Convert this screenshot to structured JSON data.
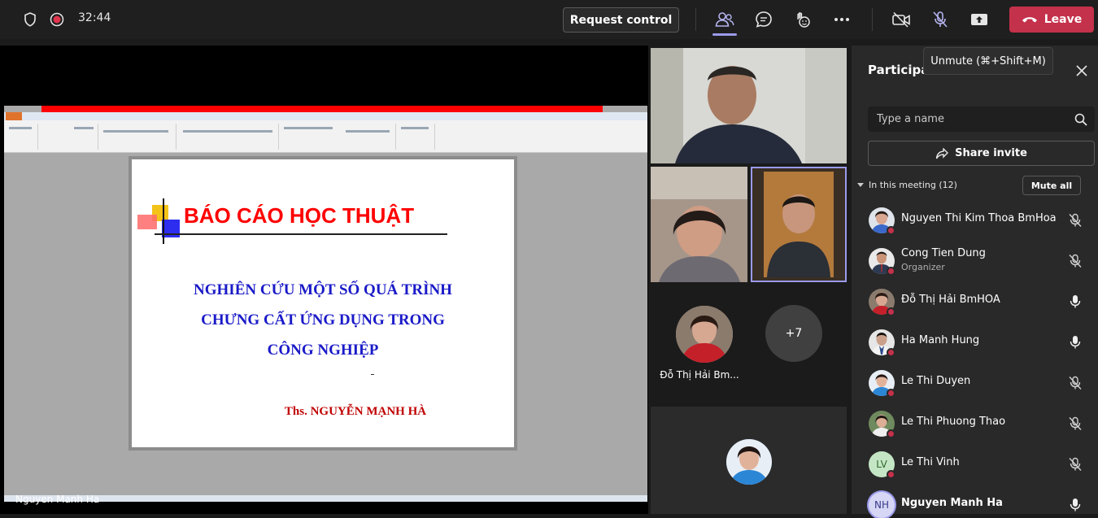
{
  "header": {
    "timer": "32:44",
    "request_control_label": "Request control",
    "leave_label": "Leave"
  },
  "tooltip": {
    "text": "Unmute (⌘+Shift+M)"
  },
  "presentation": {
    "slide_main_title": "BÁO CÁO HỌC THUẬT",
    "slide_subtitle_lines": [
      "NGHIÊN CỨU MỘT SỐ QUÁ TRÌNH",
      "CHƯNG CẤT ỨNG DỤNG TRONG",
      "CÔNG NGHIỆP"
    ],
    "slide_author": "Ths. NGUYỄN MẠNH HÀ",
    "presenter_name": "Nguyen Manh Ha"
  },
  "gallery": {
    "tile_label": "Đỗ Thị Hải Bm...",
    "more_count": "+7"
  },
  "panel": {
    "title": "Participa",
    "search_placeholder": "Type a name",
    "share_invite_label": "Share invite",
    "in_meeting_label": "In this meeting (12)",
    "mute_all_label": "Mute all",
    "participants": [
      {
        "name": "Nguyen Thi Kim Thoa BmHoa",
        "role": "",
        "mic": "muted"
      },
      {
        "name": "Cong Tien Dung",
        "role": "Organizer",
        "mic": "muted"
      },
      {
        "name": "Đỗ Thị Hải BmHOA",
        "role": "",
        "mic": "on"
      },
      {
        "name": "Ha Manh Hung",
        "role": "",
        "mic": "on"
      },
      {
        "name": "Le Thi Duyen",
        "role": "",
        "mic": "muted"
      },
      {
        "name": "Le Thi Phuong Thao",
        "role": "",
        "mic": "muted"
      },
      {
        "name": "Le Thi Vinh",
        "role": "",
        "initials": "LV",
        "mic": "muted"
      },
      {
        "name": "Nguyen Manh Ha",
        "role": "",
        "initials": "NH",
        "mic": "on"
      }
    ]
  },
  "colors": {
    "leave_red": "#c4314b",
    "accent_purple": "#9a9aeb",
    "slide_title_red": "#ff0000",
    "slide_subtitle_blue": "#1a1ac8"
  }
}
